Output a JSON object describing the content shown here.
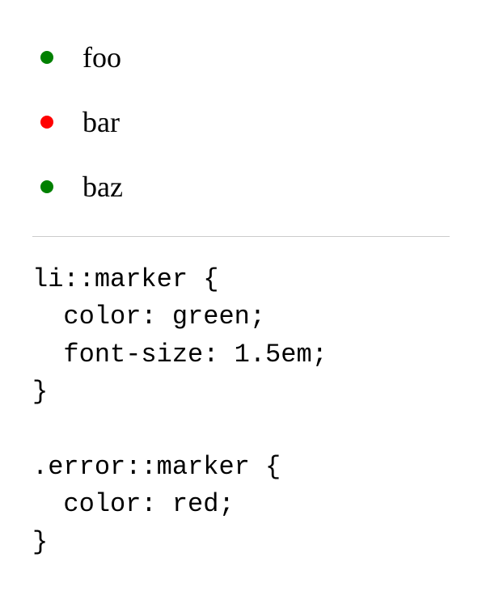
{
  "list": {
    "items": [
      {
        "label": "foo",
        "bullet_color": "green"
      },
      {
        "label": "bar",
        "bullet_color": "red"
      },
      {
        "label": "baz",
        "bullet_color": "green"
      }
    ]
  },
  "code": {
    "content": "li::marker {\n  color: green;\n  font-size: 1.5em;\n}\n\n.error::marker {\n  color: red;\n}"
  }
}
